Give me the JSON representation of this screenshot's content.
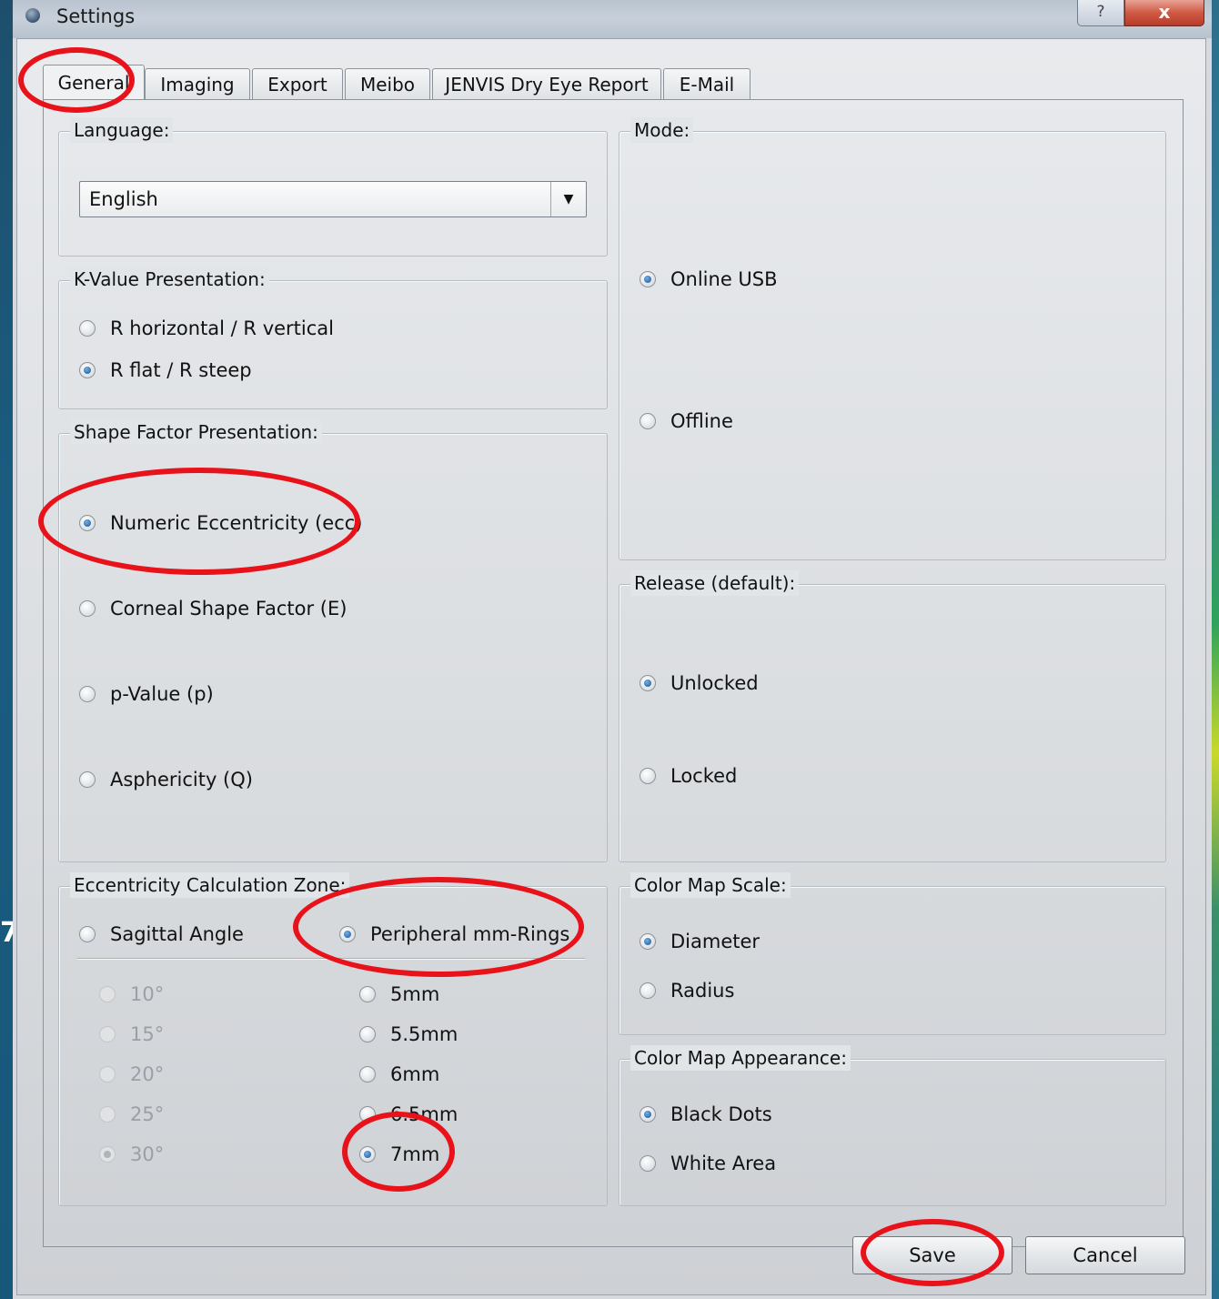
{
  "window": {
    "title": "Settings",
    "help_label": "?",
    "close_label": "x"
  },
  "tabs": [
    "General",
    "Imaging",
    "Export",
    "Meibo",
    "JENVIS Dry Eye Report",
    "E-Mail"
  ],
  "language": {
    "title": "Language:",
    "value": "English"
  },
  "kvalue": {
    "title": "K-Value Presentation:",
    "options": [
      "R horizontal / R vertical",
      "R flat / R steep"
    ],
    "selected": 1
  },
  "shape_factor": {
    "title": "Shape Factor Presentation:",
    "options": [
      "Numeric Eccentricity (ecc)",
      "Corneal Shape Factor (E)",
      "p-Value (p)",
      "Asphericity (Q)"
    ],
    "selected": 0
  },
  "ecc_zone": {
    "title": "Eccentricity Calculation Zone:",
    "mode_options": [
      "Sagittal Angle",
      "Peripheral mm-Rings"
    ],
    "mode_selected": 1,
    "angles": [
      "10°",
      "15°",
      "20°",
      "25°",
      "30°"
    ],
    "angle_selected": 4,
    "rings": [
      "5mm",
      "5.5mm",
      "6mm",
      "6.5mm",
      "7mm"
    ],
    "ring_selected": 4
  },
  "mode": {
    "title": "Mode:",
    "options": [
      "Online USB",
      "Offline"
    ],
    "selected": 0
  },
  "release": {
    "title": "Release (default):",
    "options": [
      "Unlocked",
      "Locked"
    ],
    "selected": 0
  },
  "color_map_scale": {
    "title": "Color Map Scale:",
    "options": [
      "Diameter",
      "Radius"
    ],
    "selected": 0
  },
  "color_map_appearance": {
    "title": "Color Map Appearance:",
    "options": [
      "Black Dots",
      "White Area"
    ],
    "selected": 0
  },
  "buttons": {
    "save": "Save",
    "cancel": "Cancel"
  },
  "background": {
    "edge_digit": "7"
  },
  "colors": {
    "annotation_ring": "#e8121b",
    "radio_checked": "#1c4f8f",
    "close_button": "#cf5a44"
  }
}
